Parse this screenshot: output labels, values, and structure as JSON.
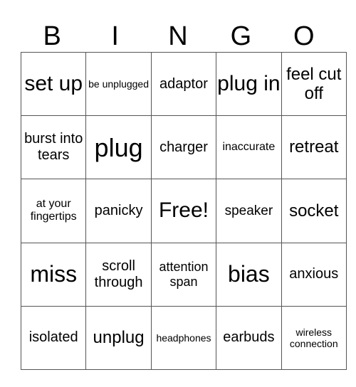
{
  "header": [
    "B",
    "I",
    "N",
    "G",
    "O"
  ],
  "rows": [
    [
      {
        "t": "set up",
        "s": 30
      },
      {
        "t": "be unplugged",
        "s": 14
      },
      {
        "t": "adaptor",
        "s": 20
      },
      {
        "t": "plug in",
        "s": 30
      },
      {
        "t": "feel cut off",
        "s": 24
      }
    ],
    [
      {
        "t": "burst into tears",
        "s": 20
      },
      {
        "t": "plug",
        "s": 36
      },
      {
        "t": "charger",
        "s": 20
      },
      {
        "t": "inaccurate",
        "s": 16
      },
      {
        "t": "retreat",
        "s": 24
      }
    ],
    [
      {
        "t": "at your fingertips",
        "s": 16
      },
      {
        "t": "panicky",
        "s": 20
      },
      {
        "t": "Free!",
        "s": 30
      },
      {
        "t": "speaker",
        "s": 19
      },
      {
        "t": "socket",
        "s": 24
      }
    ],
    [
      {
        "t": "miss",
        "s": 32
      },
      {
        "t": "scroll through",
        "s": 20
      },
      {
        "t": "attention span",
        "s": 18
      },
      {
        "t": "bias",
        "s": 32
      },
      {
        "t": "anxious",
        "s": 20
      }
    ],
    [
      {
        "t": "isolated",
        "s": 20
      },
      {
        "t": "unplug",
        "s": 24
      },
      {
        "t": "headphones",
        "s": 14
      },
      {
        "t": "earbuds",
        "s": 20
      },
      {
        "t": "wireless connection",
        "s": 14
      }
    ]
  ]
}
